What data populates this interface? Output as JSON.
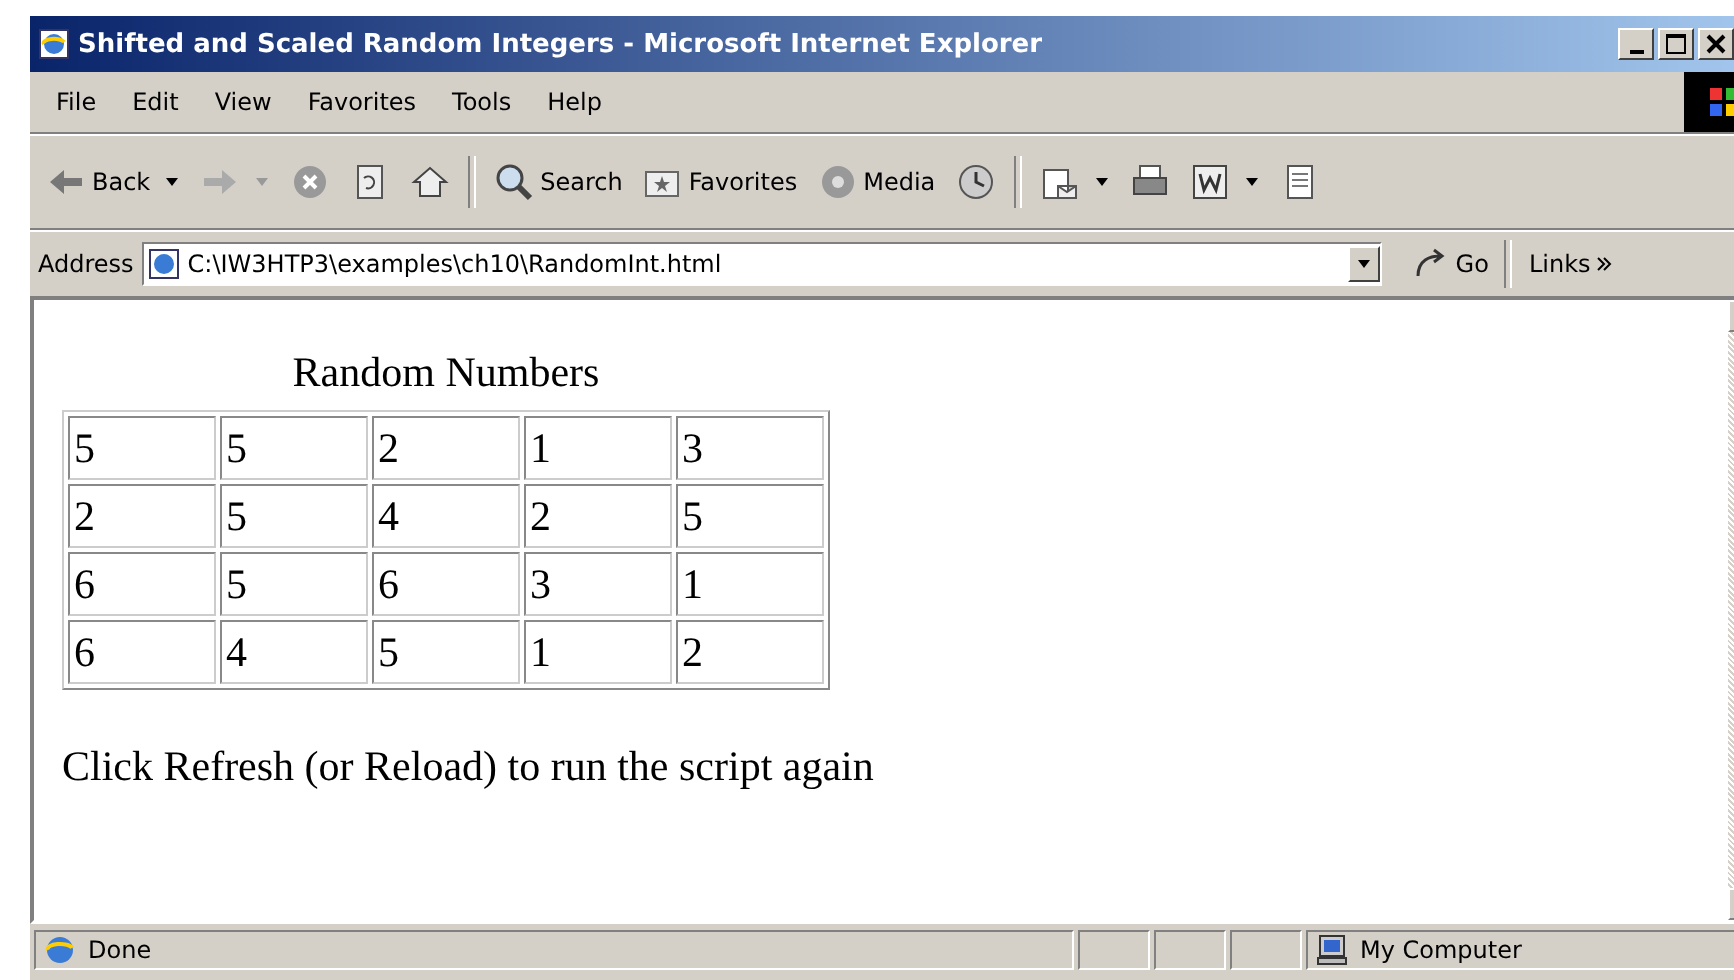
{
  "window": {
    "title": "Shifted and Scaled Random Integers - Microsoft Internet Explorer"
  },
  "menu": [
    "File",
    "Edit",
    "View",
    "Favorites",
    "Tools",
    "Help"
  ],
  "toolbar": [
    {
      "kind": "back",
      "label": "Back"
    },
    {
      "kind": "forward"
    },
    {
      "kind": "stop"
    },
    {
      "kind": "refresh"
    },
    {
      "kind": "home"
    },
    {
      "kind": "sep"
    },
    {
      "kind": "search",
      "label": "Search"
    },
    {
      "kind": "favorites",
      "label": "Favorites"
    },
    {
      "kind": "media",
      "label": "Media"
    },
    {
      "kind": "history"
    },
    {
      "kind": "sep"
    },
    {
      "kind": "mail"
    },
    {
      "kind": "print"
    },
    {
      "kind": "edit"
    },
    {
      "kind": "discuss"
    }
  ],
  "address": {
    "label": "Address",
    "value": "C:\\IW3HTP3\\examples\\ch10\\RandomInt.html",
    "go": "Go",
    "links": "Links"
  },
  "page": {
    "caption": "Random Numbers",
    "rows": [
      [
        "5",
        "5",
        "2",
        "1",
        "3"
      ],
      [
        "2",
        "5",
        "4",
        "2",
        "5"
      ],
      [
        "6",
        "5",
        "6",
        "3",
        "1"
      ],
      [
        "6",
        "4",
        "5",
        "1",
        "2"
      ]
    ],
    "note": "Click Refresh (or Reload) to run the script again"
  },
  "status_bar": {
    "text": "Done",
    "zone": "My Computer"
  }
}
